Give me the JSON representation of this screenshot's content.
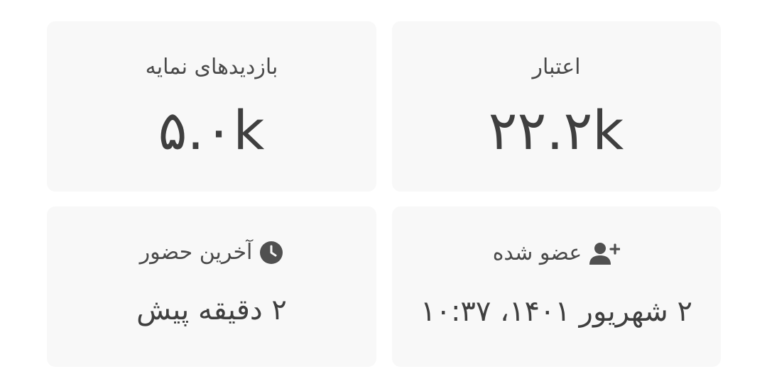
{
  "cards": {
    "impressions": {
      "title": "بازدیدهای نمایه",
      "value": "۵.۰k"
    },
    "credit": {
      "title": "اعتبار",
      "value": "۲۲.۲k"
    },
    "last_seen": {
      "title": "آخرین حضور",
      "value": "۲ دقیقه پیش",
      "icon": "clock-icon"
    },
    "joined": {
      "title": "عضو شده",
      "value": "۲ شهریور ۱۴۰۱، ۱۰:۳۷",
      "icon": "user-plus-icon"
    }
  }
}
